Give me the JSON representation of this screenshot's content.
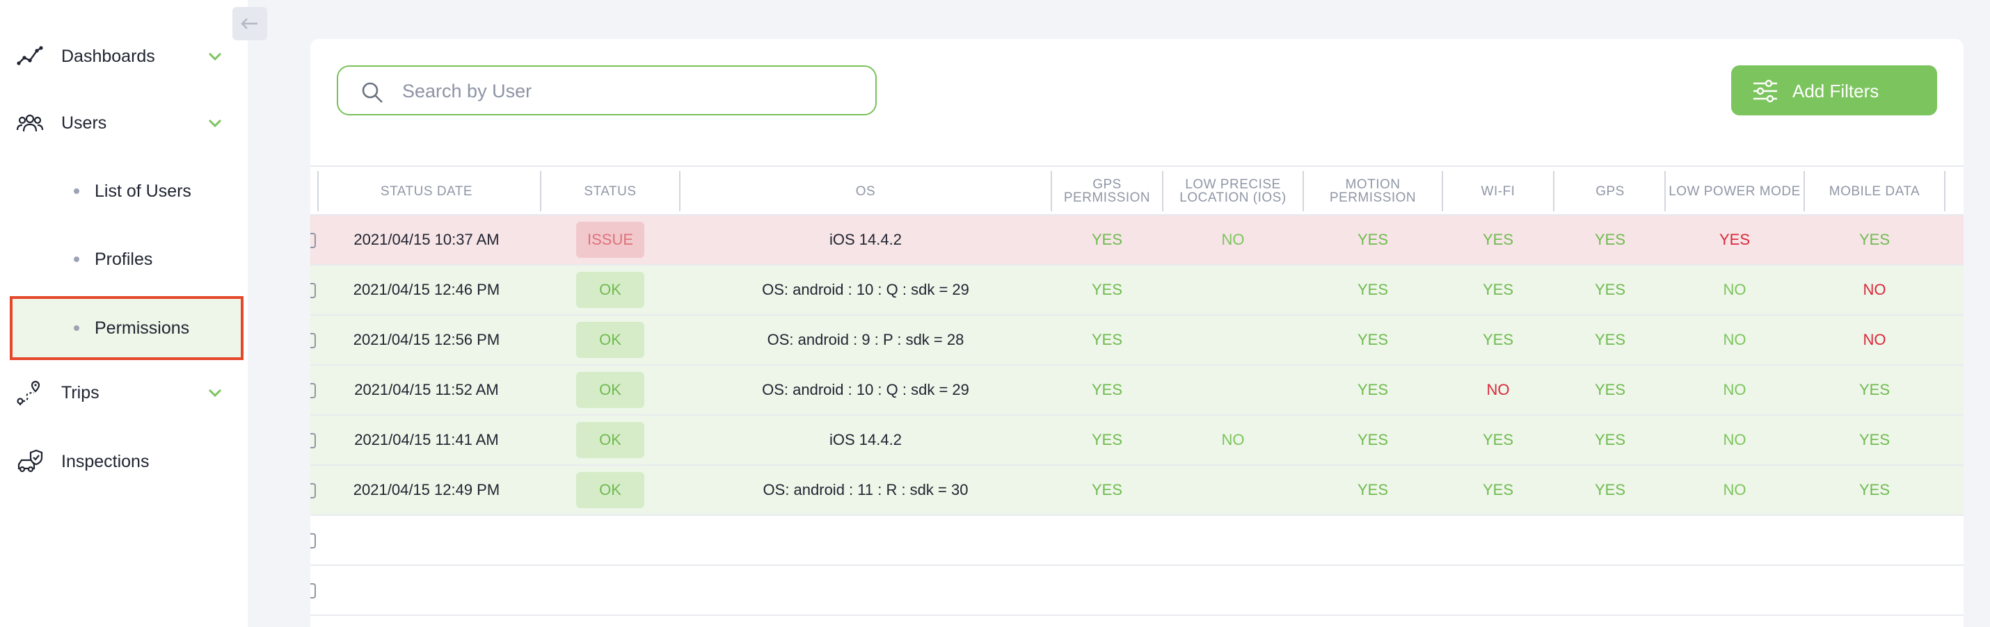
{
  "sidebar": {
    "items": [
      {
        "label": "Dashboards",
        "icon": "chart-line-icon"
      },
      {
        "label": "Users",
        "icon": "users-icon"
      },
      {
        "label": "Trips",
        "icon": "route-icon"
      },
      {
        "label": "Inspections",
        "icon": "car-shield-icon"
      }
    ],
    "users_sub": [
      {
        "label": "List of Users"
      },
      {
        "label": "Profiles"
      },
      {
        "label": "Permissions"
      }
    ],
    "active_sub": "Permissions"
  },
  "search": {
    "placeholder": "Search by User",
    "value": ""
  },
  "filters": {
    "label": "Add Filters"
  },
  "table": {
    "headers": {
      "status_date": "STATUS DATE",
      "status": "STATUS",
      "os": "OS",
      "gps_permission_1": "GPS",
      "gps_permission_2": "PERMISSION",
      "low_precise_1": "LOW PRECISE",
      "low_precise_2": "LOCATION (IOS)",
      "motion_1": "MOTION",
      "motion_2": "PERMISSION",
      "wifi": "WI-FI",
      "gps": "GPS",
      "low_power": "LOW POWER MODE",
      "mobile_data": "MOBILE DATA"
    },
    "rows": [
      {
        "date": "2021/04/15 10:37 AM",
        "status": "ISSUE",
        "os": "iOS 14.4.2",
        "gps_perm": "YES",
        "low_precise": "NO",
        "motion": "YES",
        "wifi": "YES",
        "gps": "YES",
        "low_power": "YES",
        "mobile_data": "YES"
      },
      {
        "date": "2021/04/15 12:46 PM",
        "status": "OK",
        "os": "OS: android : 10 : Q : sdk = 29",
        "gps_perm": "YES",
        "low_precise": "",
        "motion": "YES",
        "wifi": "YES",
        "gps": "YES",
        "low_power": "NO",
        "mobile_data": "NO"
      },
      {
        "date": "2021/04/15 12:56 PM",
        "status": "OK",
        "os": "OS: android : 9 : P : sdk = 28",
        "gps_perm": "YES",
        "low_precise": "",
        "motion": "YES",
        "wifi": "YES",
        "gps": "YES",
        "low_power": "NO",
        "mobile_data": "NO"
      },
      {
        "date": "2021/04/15 11:52 AM",
        "status": "OK",
        "os": "OS: android : 10 : Q : sdk = 29",
        "gps_perm": "YES",
        "low_precise": "",
        "motion": "YES",
        "wifi": "NO",
        "gps": "YES",
        "low_power": "NO",
        "mobile_data": "YES"
      },
      {
        "date": "2021/04/15 11:41 AM",
        "status": "OK",
        "os": "iOS 14.4.2",
        "gps_perm": "YES",
        "low_precise": "NO",
        "motion": "YES",
        "wifi": "YES",
        "gps": "YES",
        "low_power": "NO",
        "mobile_data": "YES"
      },
      {
        "date": "2021/04/15 12:49 PM",
        "status": "OK",
        "os": "OS: android : 11 : R : sdk = 30",
        "gps_perm": "YES",
        "low_precise": "",
        "motion": "YES",
        "wifi": "YES",
        "gps": "YES",
        "low_power": "NO",
        "mobile_data": "YES"
      }
    ]
  },
  "colors": {
    "accent_green": "#7cc45e",
    "issue_red": "#d8283a",
    "highlight_border": "#e5472b",
    "ok_row_bg": "#eef6e9",
    "issue_row_bg": "#f7e4e6"
  }
}
